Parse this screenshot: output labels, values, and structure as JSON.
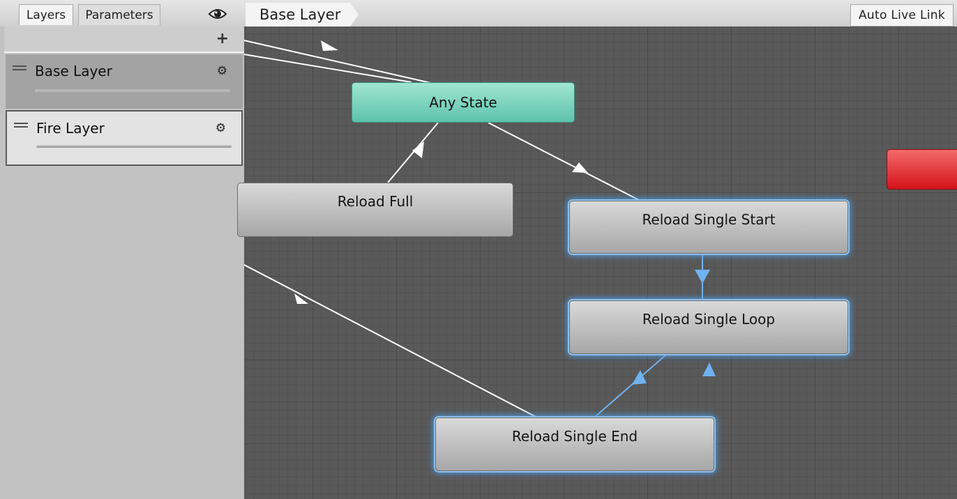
{
  "toolbar": {
    "tab_layers": "Layers",
    "tab_parameters": "Parameters",
    "breadcrumb": "Base Layer",
    "auto_live_link": "Auto Live Link"
  },
  "layers_panel": {
    "add_glyph": "+",
    "layers": [
      {
        "name": "Base Layer",
        "selected": false
      },
      {
        "name": "Fire Layer",
        "selected": true
      }
    ]
  },
  "graph": {
    "states": {
      "any_state": "Any State",
      "reload_full": "Reload Full",
      "reload_single_start": "Reload Single Start",
      "reload_single_loop": "Reload Single Loop",
      "reload_single_end": "Reload Single End"
    }
  },
  "colors": {
    "any_state": "#7fd8c2",
    "state_node": "#c0c0c0",
    "entry_red": "#e2232a",
    "selection_glow": "#4f9ae0",
    "transition": "#ffffff",
    "transition_selected": "#6fb2f0"
  },
  "icons": [
    "eye-icon",
    "plus-icon",
    "drag-handle-icon",
    "gear-icon",
    "arrow-icon"
  ]
}
